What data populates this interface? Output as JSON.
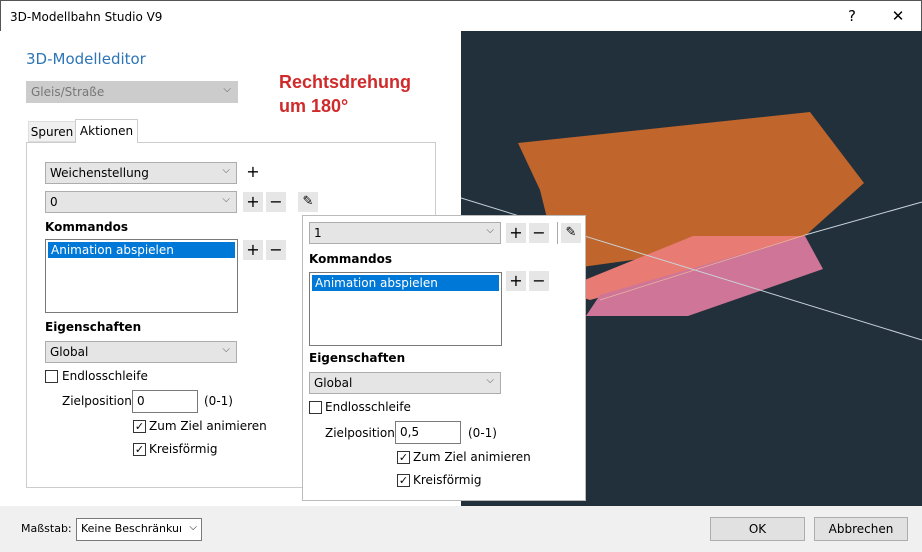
{
  "window": {
    "title": "3D-Modellbahn Studio V9",
    "help": "?",
    "close": "✕"
  },
  "editor": {
    "heading": "3D-Modelleditor",
    "category": "Gleis/Straße",
    "annotation_line1": "Rechtsdrehung",
    "annotation_line2": "um 180°",
    "tabs": [
      {
        "label": "Spuren"
      },
      {
        "label": "Aktionen"
      }
    ]
  },
  "left": {
    "action": "Weichenstellung",
    "state": "0",
    "commands_label": "Kommandos",
    "commands": [
      "Animation abspielen"
    ],
    "properties_label": "Eigenschaften",
    "scope": "Global",
    "loop_label": "Endlosschleife",
    "loop": false,
    "target_label": "Zielposition:",
    "target_value": "0",
    "range": "(0-1)",
    "animate_label": "Zum Ziel animieren",
    "animate": true,
    "circular_label": "Kreisförmig",
    "circular": true
  },
  "overlay": {
    "state": "1",
    "commands_label": "Kommandos",
    "commands": [
      "Animation abspielen"
    ],
    "properties_label": "Eigenschaften",
    "scope": "Global",
    "loop_label": "Endlosschleife",
    "loop": false,
    "target_label": "Zielposition:",
    "target_value": "0,5",
    "range": "(0-1)",
    "animate_label": "Zum Ziel animieren",
    "animate": true,
    "circular_label": "Kreisförmig",
    "circular": true
  },
  "icons": {
    "plus": "+",
    "minus": "−",
    "edit": "✎",
    "check": "✓",
    "chevron": "⌵"
  },
  "colors": {
    "accent": "#2e75b6",
    "annotation": "#d02a2a",
    "viewport": "#22303b",
    "face_top": "#c0652c",
    "face_salmon": "#e87b73",
    "face_pink": "#cf7698"
  },
  "footer": {
    "scale_label": "Maßstab:",
    "scale_value": "Keine Beschränkung",
    "ok": "OK",
    "cancel": "Abbrechen"
  }
}
